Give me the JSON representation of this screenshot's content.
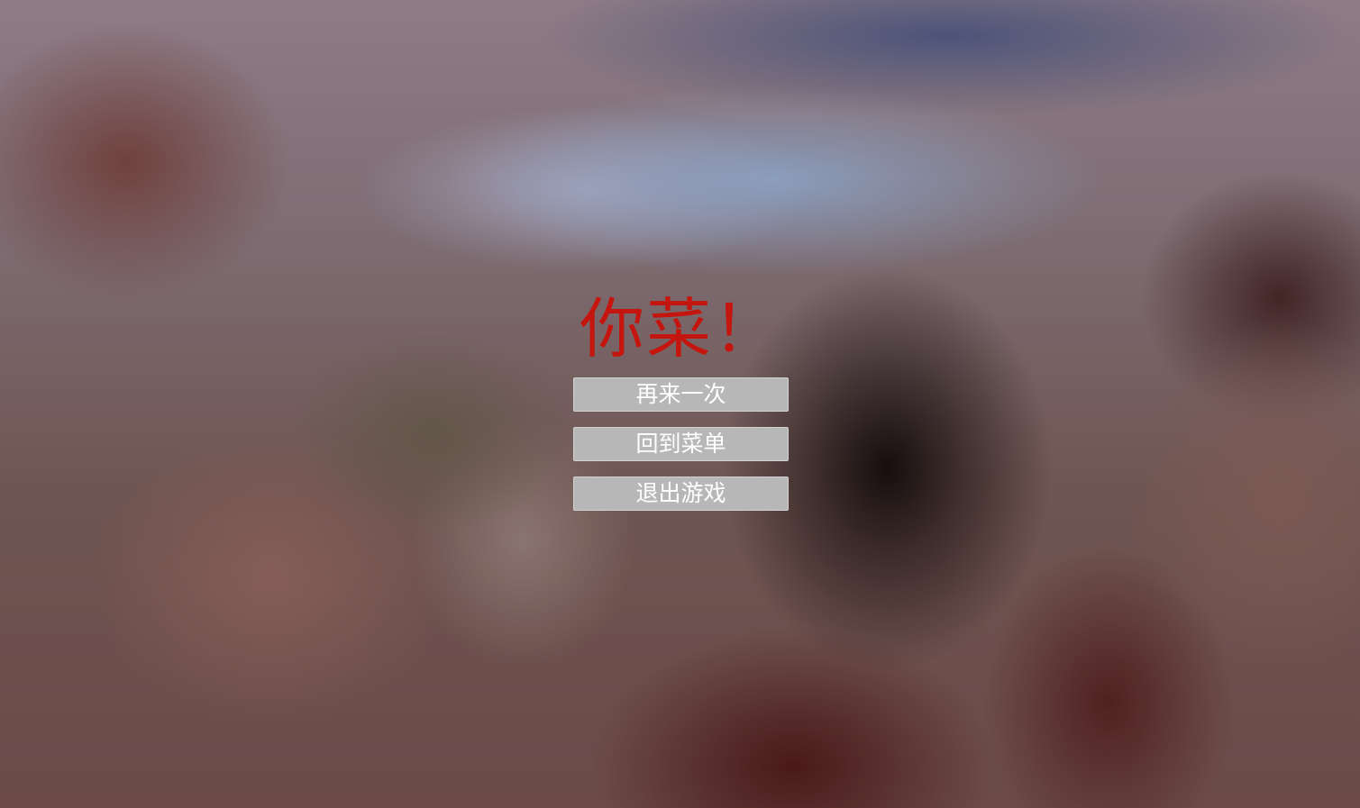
{
  "game_over": {
    "title": "你菜！",
    "title_color": "#c4160e"
  },
  "menu": {
    "retry_label": "再来一次",
    "back_to_menu_label": "回到菜单",
    "quit_label": "退出游戏",
    "button_color": "#b7b7b7",
    "button_text_color": "#ffffff"
  }
}
